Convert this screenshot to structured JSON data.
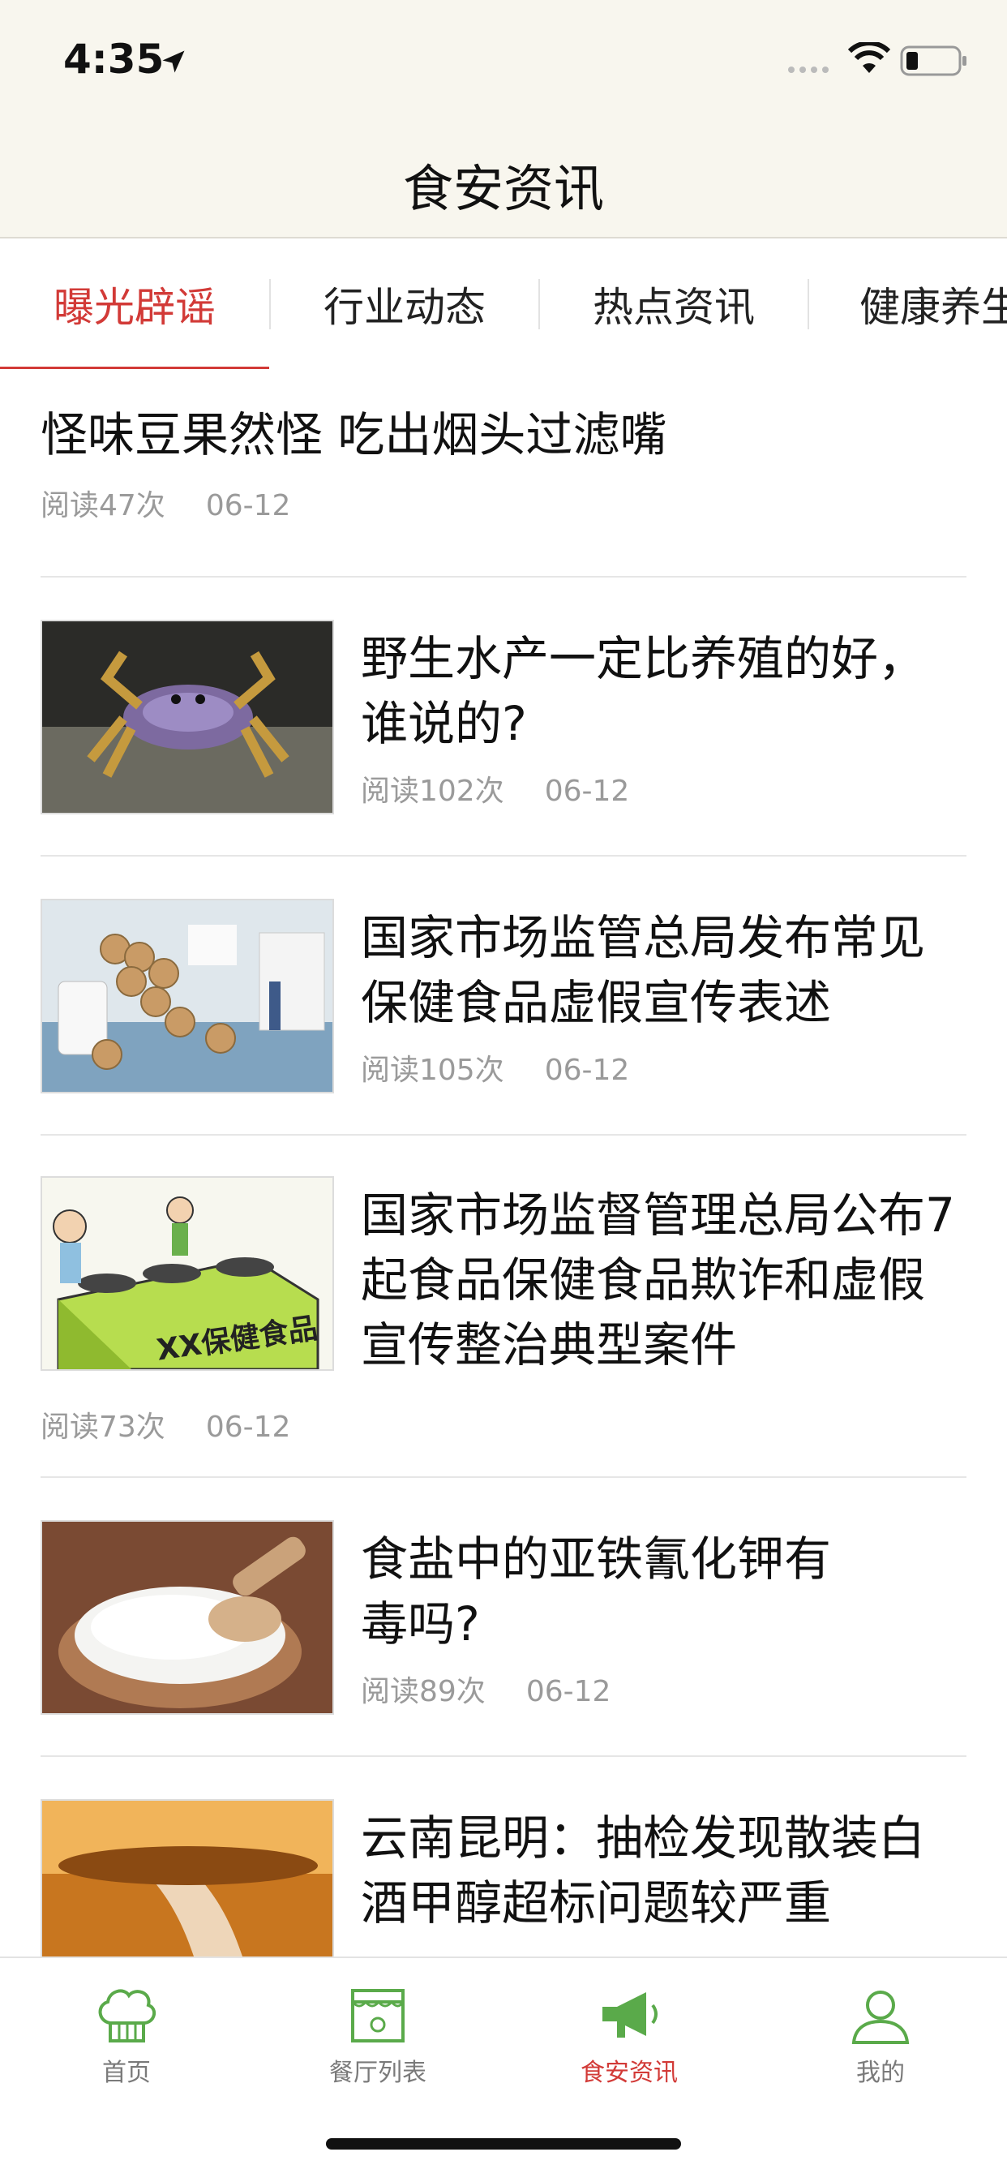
{
  "status": {
    "time": "4:35"
  },
  "nav": {
    "title": "食安资讯"
  },
  "tabs": [
    {
      "label": "曝光辟谣",
      "active": true
    },
    {
      "label": "行业动态",
      "active": false
    },
    {
      "label": "热点资讯",
      "active": false
    },
    {
      "label": "健康养生",
      "active": false
    }
  ],
  "articles": [
    {
      "title": "怪味豆果然怪 吃出烟头过滤嘴",
      "reads": "阅读47次",
      "date": "06-12",
      "thumb": "none"
    },
    {
      "title": "野生水产一定比养殖的好，谁说的?",
      "reads": "阅读102次",
      "date": "06-12",
      "thumb": "crab"
    },
    {
      "title": "国家市场监管总局发布常见保健食品虚假宣传表述",
      "reads": "阅读105次",
      "date": "06-12",
      "thumb": "pills"
    },
    {
      "title": "国家市场监督管理总局公布7起食品保健食品欺诈和虚假宣传整治典型案件",
      "reads": "阅读73次",
      "date": "06-12",
      "thumb": "cartoon",
      "cartoon_text": "XX保健食品"
    },
    {
      "title": "食盐中的亚铁氰化钾有毒吗?",
      "reads": "阅读89次",
      "date": "06-12",
      "thumb": "salt"
    },
    {
      "title": "云南昆明：抽检发现散装白酒甲醇超标问题较严重",
      "reads": "",
      "date": "",
      "thumb": "liquor"
    }
  ],
  "tabbar": [
    {
      "label": "首页",
      "icon": "chef-hat-icon",
      "active": false
    },
    {
      "label": "餐厅列表",
      "icon": "restaurant-storefront-icon",
      "active": false
    },
    {
      "label": "食安资讯",
      "icon": "megaphone-icon",
      "active": true
    },
    {
      "label": "我的",
      "icon": "user-icon",
      "active": false
    }
  ],
  "colors": {
    "accent": "#d23a37",
    "icon_green": "#5aaa4a",
    "nav_bg": "#f8f6ee"
  }
}
